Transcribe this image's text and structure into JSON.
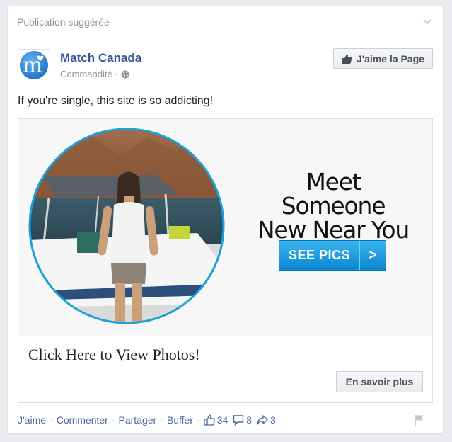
{
  "header": {
    "title": "Publication suggérée"
  },
  "post": {
    "page_name": "Match Canada",
    "sponsored_label": "Commandité",
    "dot": "·",
    "like_page_label": "J'aime la Page",
    "message": "If you're single, this site is so addicting!"
  },
  "ad": {
    "headline_line1": "Meet Someone",
    "headline_line2": "New Near You",
    "cta_label": "SEE PICS",
    "cta_arrow": ">",
    "caption": "Click Here to View Photos!",
    "learn_more_label": "En savoir plus"
  },
  "actions": {
    "like": "J'aime",
    "comment": "Commenter",
    "share": "Partager",
    "buffer": "Buffer",
    "separator": "·",
    "like_count": "34",
    "comment_count": "8",
    "share_count": "3"
  },
  "colors": {
    "link": "#365899",
    "action_link": "#4b67a1",
    "muted": "#90949c",
    "cta_blue": "#1a9be0",
    "logo_blue": "#2a7fd4"
  },
  "icons": [
    "chevron-down-icon",
    "globe-icon",
    "thumbs-up-icon",
    "comment-icon",
    "share-icon",
    "flag-icon",
    "match-logo"
  ]
}
